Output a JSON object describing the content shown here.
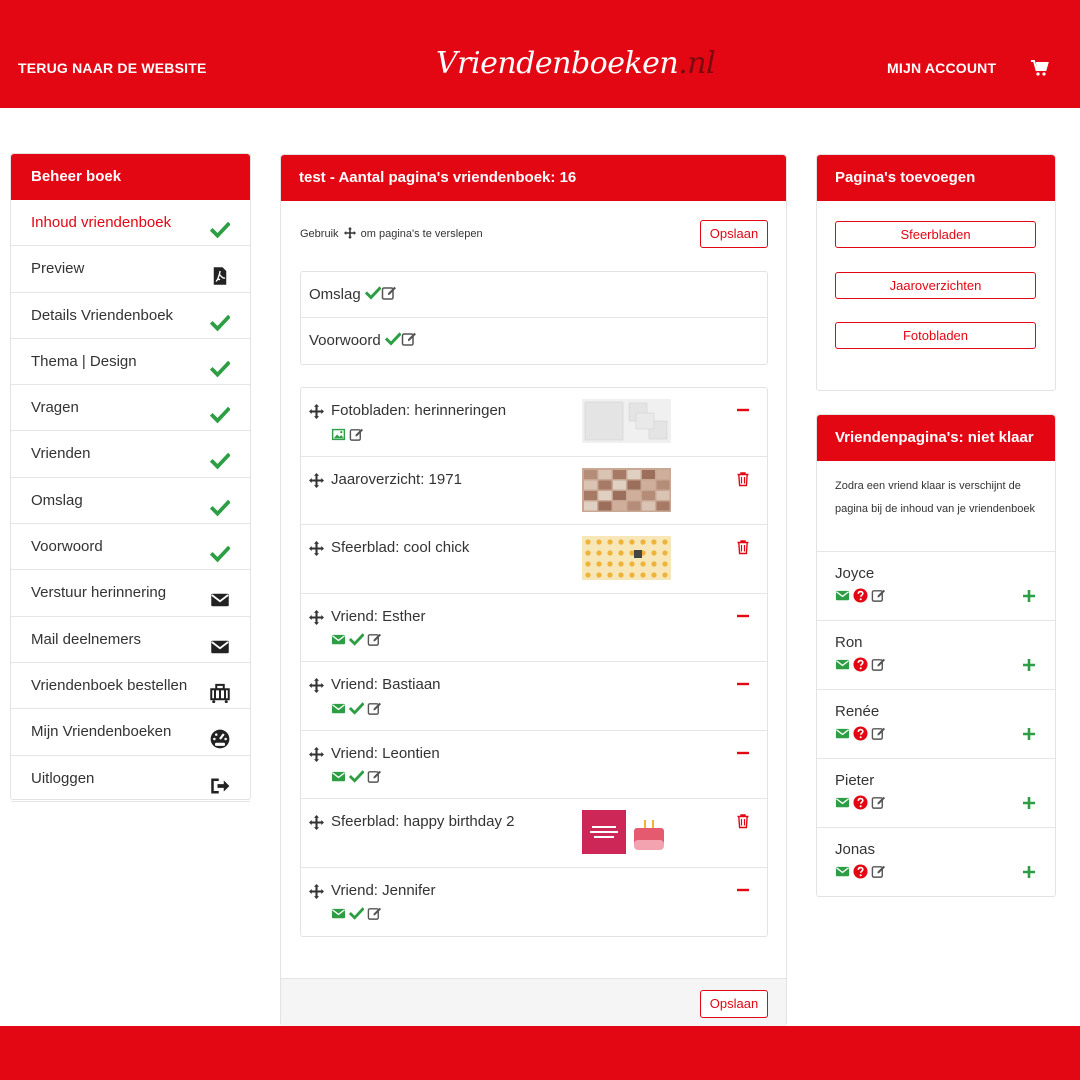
{
  "header": {
    "back_label": "TERUG NAAR DE WEBSITE",
    "logo_main": "Vriendenboeken",
    "logo_suffix": ".nl",
    "account_label": "MIJN ACCOUNT",
    "cart_icon": "cart-icon"
  },
  "colors": {
    "brand": "#e30613",
    "success": "#2e9e44",
    "border": "#e3e3e3"
  },
  "sidebar": {
    "title": "Beheer boek",
    "items": [
      {
        "label": "Inhoud vriendenboek",
        "icon": "check-icon",
        "active": true
      },
      {
        "label": "Preview",
        "icon": "pdf-icon"
      },
      {
        "label": "Details Vriendenboek",
        "icon": "check-icon"
      },
      {
        "label": "Thema | Design",
        "icon": "check-icon"
      },
      {
        "label": "Vragen",
        "icon": "check-icon"
      },
      {
        "label": "Vrienden",
        "icon": "check-icon"
      },
      {
        "label": "Omslag",
        "icon": "check-icon"
      },
      {
        "label": "Voorwoord",
        "icon": "check-icon"
      },
      {
        "label": "Verstuur herinnering",
        "icon": "envelope-icon"
      },
      {
        "label": "Mail deelnemers",
        "icon": "envelope-icon"
      },
      {
        "label": "Vriendenboek bestellen",
        "icon": "luggage-icon"
      },
      {
        "label": "Mijn Vriendenboeken",
        "icon": "dashboard-icon"
      },
      {
        "label": "Uitloggen",
        "icon": "sign-out-icon"
      }
    ]
  },
  "content": {
    "title": "test - Aantal pagina's vriendenboek: 16",
    "hint_before": "Gebruik",
    "hint_after": "om pagina's te verslepen",
    "save_label": "Opslaan",
    "fixed_pages": [
      {
        "label": "Omslag"
      },
      {
        "label": "Voorwoord"
      }
    ],
    "pages": [
      {
        "label": "Fotobladen: herinneringen",
        "icons": [
          "image-icon",
          "edit-icon"
        ],
        "thumb": "photo-layout",
        "action": "minus"
      },
      {
        "label": "Jaaroverzicht: 1971",
        "icons": [],
        "thumb": "newspaper",
        "action": "trash"
      },
      {
        "label": "Sfeerblad: cool chick",
        "icons": [],
        "thumb": "chicks",
        "action": "trash"
      },
      {
        "label": "Vriend: Esther",
        "icons": [
          "envelope-icon",
          "check-icon",
          "edit-icon"
        ],
        "thumb": "",
        "action": "minus"
      },
      {
        "label": "Vriend: Bastiaan",
        "icons": [
          "envelope-icon",
          "check-icon",
          "edit-icon"
        ],
        "thumb": "",
        "action": "minus"
      },
      {
        "label": "Vriend: Leontien",
        "icons": [
          "envelope-icon",
          "check-icon",
          "edit-icon"
        ],
        "thumb": "",
        "action": "minus"
      },
      {
        "label": "Sfeerblad: happy birthday 2",
        "icons": [],
        "thumb": "birthday",
        "action": "trash"
      },
      {
        "label": "Vriend: Jennifer",
        "icons": [
          "envelope-icon",
          "check-icon",
          "edit-icon"
        ],
        "thumb": "",
        "action": "minus"
      }
    ]
  },
  "add_pages": {
    "title": "Pagina's toevoegen",
    "buttons": [
      "Sfeerbladen",
      "Jaaroverzichten",
      "Fotobladen"
    ]
  },
  "friends_pending": {
    "title": "Vriendenpagina's: niet klaar",
    "info": "Zodra een vriend klaar is verschijnt de pagina bij de inhoud van je vriendenboek",
    "friends": [
      {
        "name": "Joyce"
      },
      {
        "name": "Ron"
      },
      {
        "name": "Renée"
      },
      {
        "name": "Pieter"
      },
      {
        "name": "Jonas"
      }
    ]
  }
}
